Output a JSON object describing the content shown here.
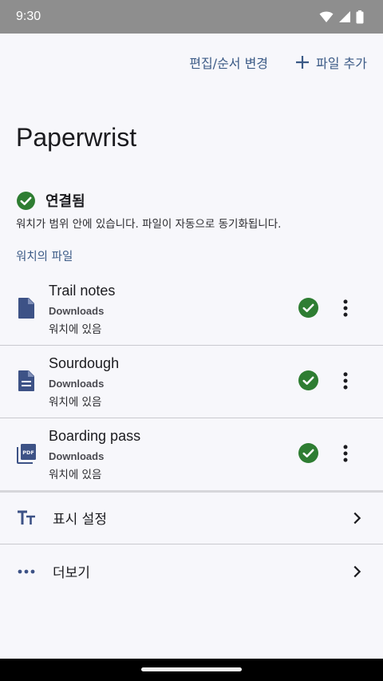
{
  "status_bar": {
    "time": "9:30"
  },
  "header": {
    "edit_label": "편집/순서 변경",
    "add_file_label": "파일 추가",
    "title": "Paperwrist"
  },
  "connection": {
    "label": "연결됨",
    "description": "워치가 범위 안에 있습니다. 파일이 자동으로 동기화됩니다."
  },
  "files_section": {
    "label": "워치의 파일",
    "items": [
      {
        "name": "Trail notes",
        "location": "Downloads",
        "status": "워치에 있음",
        "icon": "file-icon"
      },
      {
        "name": "Sourdough",
        "location": "Downloads",
        "status": "워치에 있음",
        "icon": "document-icon"
      },
      {
        "name": "Boarding pass",
        "location": "Downloads",
        "status": "워치에 있음",
        "icon": "pdf-icon"
      }
    ]
  },
  "menu": {
    "display_settings": "표시 설정",
    "more": "더보기"
  },
  "colors": {
    "accent": "#3b5a86",
    "success": "#2e7d32",
    "icon": "#3d5286"
  }
}
